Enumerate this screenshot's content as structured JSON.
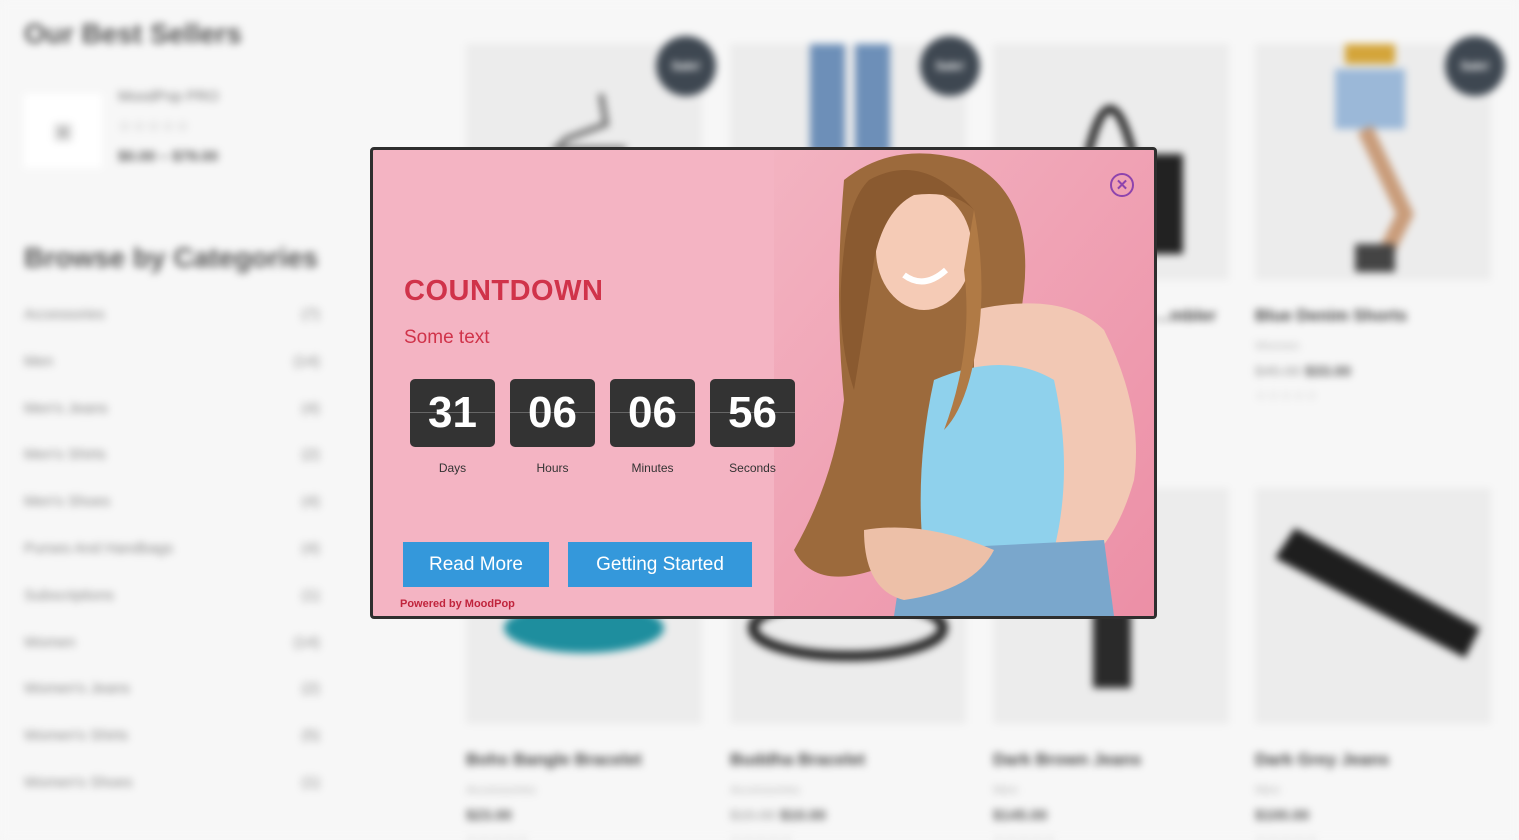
{
  "background": {
    "best_sellers": {
      "heading": "Our Best Sellers",
      "item": {
        "name": "MoodPop PRO",
        "stars": "☆☆☆☆☆",
        "price": "$0.00 – $79.00"
      }
    },
    "categories": {
      "heading": "Browse by Categories",
      "items": [
        {
          "name": "Accessories",
          "count": "(7)"
        },
        {
          "name": "Men",
          "count": "(14)"
        },
        {
          "name": "Men's Jeans",
          "count": "(4)"
        },
        {
          "name": "Men's Shirts",
          "count": "(2)"
        },
        {
          "name": "Men's Shoes",
          "count": "(4)"
        },
        {
          "name": "Purses And Handbags",
          "count": "(4)"
        },
        {
          "name": "Subscriptions",
          "count": "(1)"
        },
        {
          "name": "Women",
          "count": "(14)"
        },
        {
          "name": "Women's Jeans",
          "count": "(2)"
        },
        {
          "name": "Women's Shirts",
          "count": "(5)"
        },
        {
          "name": "Women's Shoes",
          "count": "(1)"
        }
      ]
    },
    "products": [
      {
        "sale": "Sale!",
        "name": "",
        "category": "",
        "old_price": "",
        "price": "",
        "stars": ""
      },
      {
        "sale": "Sale!",
        "name": "",
        "category": "",
        "old_price": "",
        "price": "",
        "stars": ""
      },
      {
        "sale": "",
        "name": "…mbler",
        "category": "",
        "old_price": "",
        "price": "",
        "stars": ""
      },
      {
        "sale": "Sale!",
        "name": "Blue Denim Shorts",
        "category": "Women",
        "old_price": "$45.00",
        "price": "$33.00",
        "stars": "☆☆☆☆☆"
      },
      {
        "sale": "",
        "name": "Bohs Bangle Bracelet",
        "category": "Accessories",
        "old_price": "",
        "price": "$23.00",
        "stars": "☆☆☆☆☆"
      },
      {
        "sale": "",
        "name": "Buddha Bracelet",
        "category": "Accessories",
        "old_price": "$15.00",
        "price": "$10.00",
        "stars": "☆☆☆☆☆"
      },
      {
        "sale": "",
        "name": "Dark Brown Jeans",
        "category": "Men",
        "old_price": "",
        "price": "$145.00",
        "stars": "☆☆☆☆☆"
      },
      {
        "sale": "",
        "name": "Dark Grey Jeans",
        "category": "Men",
        "old_price": "",
        "price": "$100.00",
        "stars": "☆☆☆☆☆"
      }
    ]
  },
  "popup": {
    "close_icon": "close-circle-icon",
    "close_glyph": "✕",
    "title": "COUNTDOWN",
    "subtitle": "Some text",
    "countdown": [
      {
        "value": "31",
        "label": "Days"
      },
      {
        "value": "06",
        "label": "Hours"
      },
      {
        "value": "06",
        "label": "Minutes"
      },
      {
        "value": "56",
        "label": "Seconds"
      }
    ],
    "read_more_label": "Read More",
    "getting_started_label": "Getting Started",
    "powered_by": "Powered by MoodPop",
    "colors": {
      "background": "#f4b4c3",
      "title": "#d0334a",
      "button": "#3498db",
      "digit_box": "#333333",
      "close": "#8e44ad"
    }
  }
}
